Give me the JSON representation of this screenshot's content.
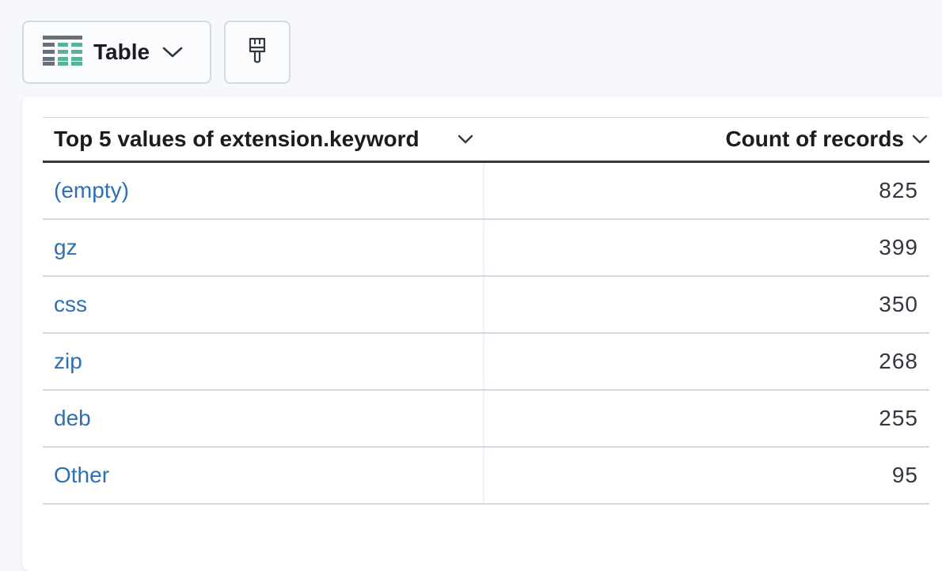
{
  "toolbar": {
    "chart_type_label": "Table",
    "chart_type_icon": "table-icon",
    "style_icon": "paintbrush-icon"
  },
  "table": {
    "columns": [
      {
        "label": "Top 5 values of extension.keyword"
      },
      {
        "label": "Count of records"
      }
    ],
    "rows": [
      {
        "value": "(empty)",
        "count": "825"
      },
      {
        "value": "gz",
        "count": "399"
      },
      {
        "value": "css",
        "count": "350"
      },
      {
        "value": "zip",
        "count": "268"
      },
      {
        "value": "deb",
        "count": "255"
      },
      {
        "value": "Other",
        "count": "95"
      }
    ]
  },
  "colors": {
    "link": "#2f6fb3",
    "table_icon_accent": "#54b399",
    "table_icon_gray": "#69707d"
  }
}
